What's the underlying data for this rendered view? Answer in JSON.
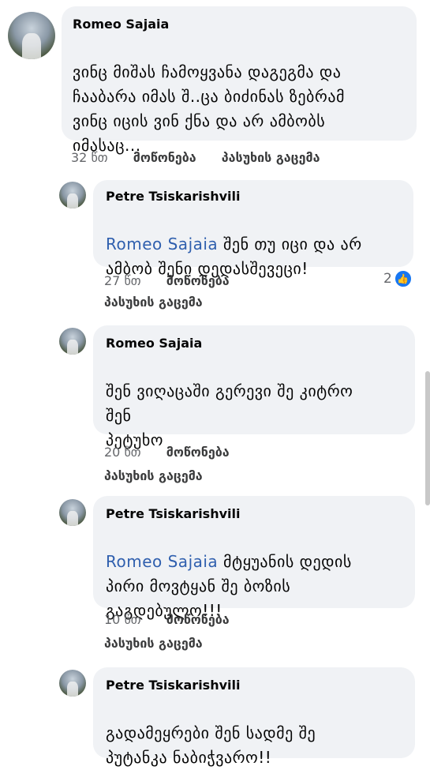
{
  "comments": [
    {
      "author": "Romeo Sajaia",
      "mention": "",
      "text": "ვინც მიშას ჩამოყვანა დაგეგმა და\nჩააბარა იმას შ..ცა ბიძინას ზებრამ\nვინც იცის ვინ ქნა  და არ ამბობს\nიმასაც...",
      "time": "32 წთ",
      "like_label": "მოწონება",
      "reply_label": "პასუხის გაცემა"
    },
    {
      "author": "Petre Tsiskarishvili",
      "mention": "Romeo Sajaia",
      "text": " შენ თუ იცი და არ\nამბობ შენი დედასშევეცი!",
      "time": "27 წთ",
      "like_label": "მოწონება",
      "reply_label": "პასუხის გაცემა",
      "reaction_count": "2"
    },
    {
      "author": "Romeo Sajaia",
      "mention": "",
      "text": "შენ ვიღაცაში გერევი შე კიტრო\nშენ\nპეტუხო",
      "time": "20 წთ",
      "like_label": "მოწონება",
      "reply_label": "პასუხის გაცემა"
    },
    {
      "author": "Petre Tsiskarishvili",
      "mention": "Romeo Sajaia",
      "text": " მტყუანის დედის\nპირი მოვტყან შე ბოზის\nგაგდებულო!!!",
      "time": "10 წთ",
      "like_label": "მოწონება",
      "reply_label": "პასუხის გაცემა"
    },
    {
      "author": "Petre Tsiskarishvili",
      "mention": "",
      "text": "გადამეყრები შენ სადმე შე\nპუტანკა ნაბიჭვარო!!",
      "time": "",
      "like_label": "",
      "reply_label": ""
    }
  ],
  "colors": {
    "bubble": "#f0f2f5",
    "mention": "#2f5fae",
    "like_badge": "#1877f2"
  },
  "icons": {
    "like": "like-thumb-icon"
  }
}
